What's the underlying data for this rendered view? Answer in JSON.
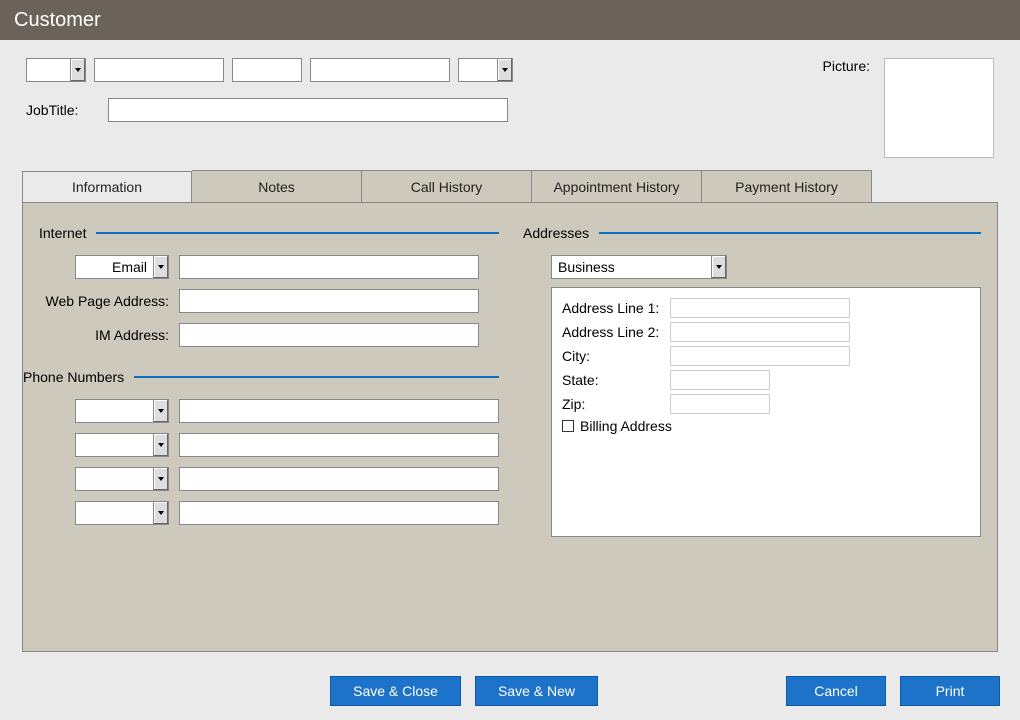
{
  "title": "Customer",
  "topSelects": {
    "prefix": "",
    "suffix": ""
  },
  "nameFields": {
    "first": "",
    "middle": "",
    "last": ""
  },
  "jobTitleLabel": "JobTitle:",
  "jobTitleValue": "",
  "pictureLabel": "Picture:",
  "tabs": {
    "information": "Information",
    "notes": "Notes",
    "callHistory": "Call History",
    "appointmentHistory": "Appointment History",
    "paymentHistory": "Payment History"
  },
  "internet": {
    "heading": "Internet",
    "emailTypeSelected": "Email",
    "emailValue": "",
    "webLabel": "Web Page Address:",
    "webValue": "",
    "imLabel": "IM Address:",
    "imValue": ""
  },
  "phones": {
    "heading": "Phone Numbers",
    "rows": [
      "",
      "",
      "",
      ""
    ]
  },
  "addresses": {
    "heading": "Addresses",
    "typeSelected": "Business",
    "line1Label": "Address Line 1:",
    "line1": "",
    "line2Label": "Address Line 2:",
    "line2": "",
    "cityLabel": "City:",
    "city": "",
    "stateLabel": "State:",
    "state": "",
    "zipLabel": "Zip:",
    "zip": "",
    "billingLabel": "Billing Address"
  },
  "buttons": {
    "saveClose": "Save & Close",
    "saveNew": "Save & New",
    "cancel": "Cancel",
    "print": "Print"
  }
}
